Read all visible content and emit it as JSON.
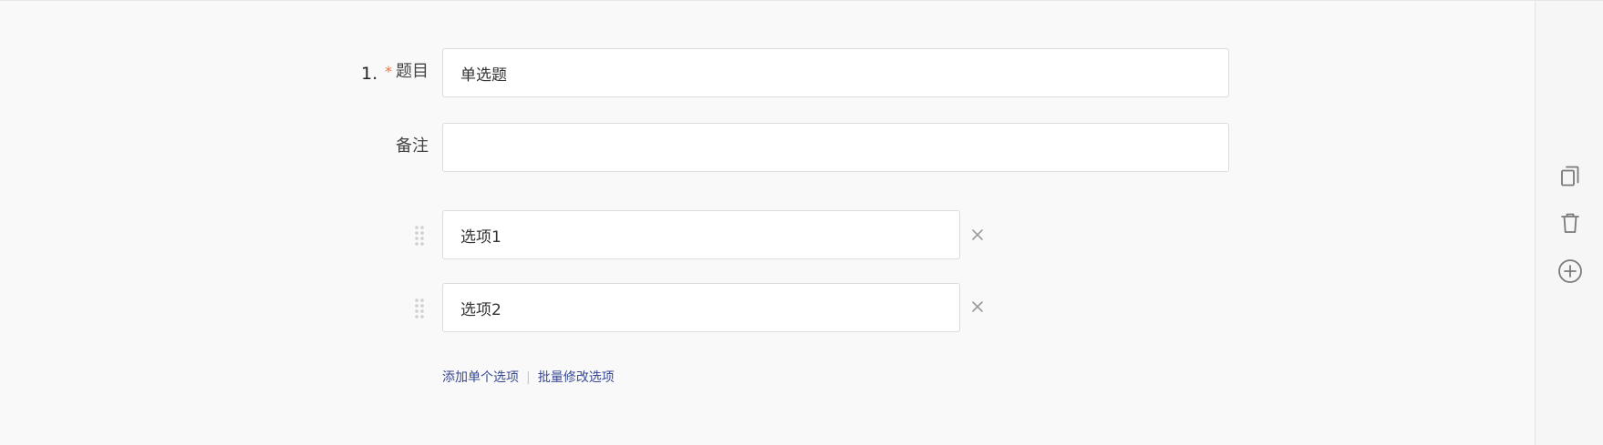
{
  "question": {
    "number": "1.",
    "required_mark": "*",
    "title_label": "题目",
    "title_value": "单选题",
    "note_label": "备注",
    "note_value": ""
  },
  "options": [
    {
      "value": "选项1"
    },
    {
      "value": "选项2"
    }
  ],
  "actions": {
    "add_single": "添加单个选项",
    "separator": "|",
    "batch_edit": "批量修改选项"
  },
  "side_tools": [
    {
      "icon": "copy-icon"
    },
    {
      "icon": "trash-icon"
    },
    {
      "icon": "plus-circle-icon"
    }
  ],
  "colors": {
    "link": "#3a4a92",
    "required": "#e07a45",
    "background": "#f9f9f9"
  }
}
